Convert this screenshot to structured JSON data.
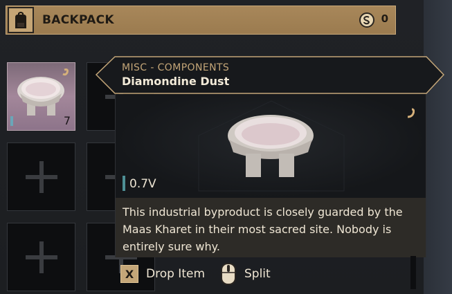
{
  "header": {
    "title": "BACKPACK",
    "currency_count": "0"
  },
  "inventory": {
    "items": [
      {
        "quantity": "7"
      }
    ]
  },
  "tooltip": {
    "category": "MISC - COMPONENTS",
    "name": "Diamondine Dust",
    "weight": "0.7V",
    "description": "This industrial byproduct is closely guarded by the Maas Kharet in their most sacred site. Nobody is entirely sure why."
  },
  "actions": {
    "drop_key": "X",
    "drop_label": "Drop Item",
    "split_label": "Split"
  },
  "colors": {
    "header_gold": "#a8875a",
    "accent_gold": "#c4a678",
    "item_slot_bg": "#a3879a",
    "weight_bar": "#4e8f95"
  },
  "icons": [
    "backpack-icon",
    "currency-coin-icon",
    "add-slot-icon",
    "mouse-icon",
    "tag-icon"
  ]
}
